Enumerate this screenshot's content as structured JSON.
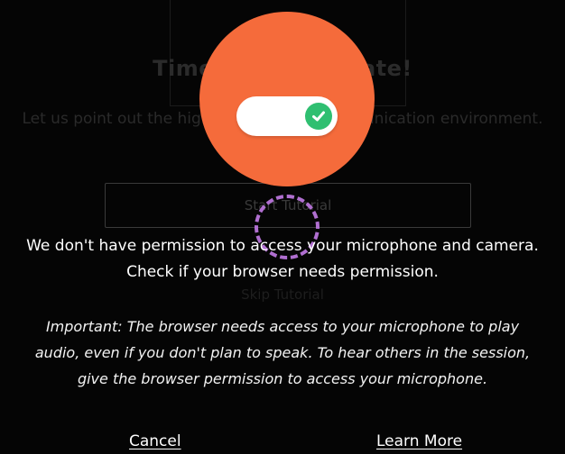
{
  "background": {
    "title": "Time to Collaborate!",
    "subtitle": "Let us point out the highlights of your communication environment.",
    "start_button_label": "Start Tutorial",
    "skip_label": "Skip Tutorial"
  },
  "overlay": {
    "toggle_state": "on",
    "message_line_1": "We don't have permission to access your microphone and camera.",
    "message_line_2": "Check if your browser needs permission.",
    "important_text": "Important: The browser needs access to your microphone to play audio, even if you don't plan to speak. To hear others in the session, give the browser permission to access your microphone.",
    "cancel_label": "Cancel",
    "learn_more_label": "Learn More"
  },
  "colors": {
    "orange_accent": "#f56b3b",
    "toggle_green": "#2fbf71",
    "focus_ring_purple": "#b06fd0"
  },
  "icons": {
    "toggle_check": "checkmark-icon"
  }
}
